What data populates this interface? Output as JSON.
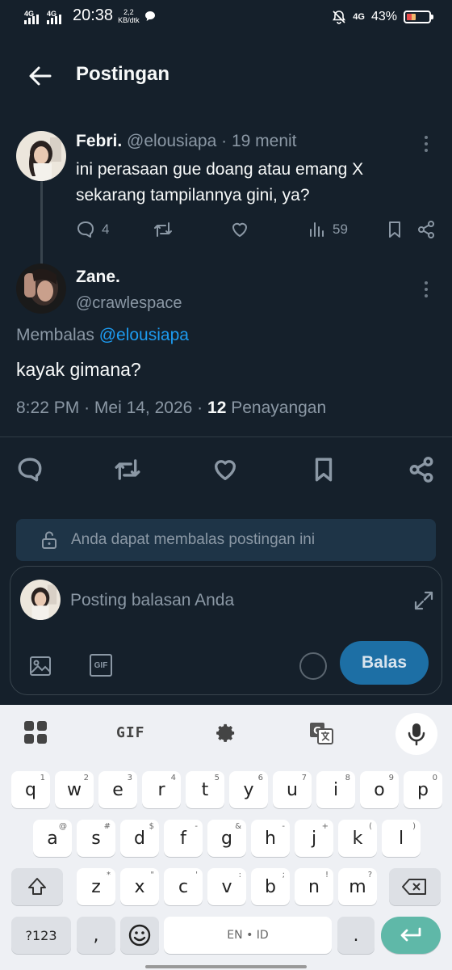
{
  "status_bar": {
    "network1": "4G",
    "network2": "4G",
    "time": "20:38",
    "speed_value": "2,2",
    "speed_unit": "KB/dtk",
    "network3": "4G",
    "battery": "43%",
    "battery_level": 0.43
  },
  "header": {
    "title": "Postingan"
  },
  "parent_post": {
    "name": "Febri.",
    "handle": "@elousiapa",
    "separator": "·",
    "time": "19 menit",
    "text": "ini perasaan gue doang atau emang X sekarang tampilannya gini, ya?",
    "replies": "4",
    "views": "59"
  },
  "main_post": {
    "name": "Zane.",
    "handle": "@crawlespace",
    "reply_prefix": "Membalas",
    "reply_to": "@elousiapa",
    "text": "kayak gimana?",
    "timestamp": "8:22 PM",
    "sep": "·",
    "date": "Mei 14, 2026",
    "views_count": "12",
    "views_label": "Penayangan"
  },
  "reply_notice": "Anda dapat membalas postingan ini",
  "composer": {
    "placeholder": "Posting balasan Anda",
    "gif_label": "GIF",
    "reply_button": "Balas"
  },
  "keyboard": {
    "gif_label": "GIF",
    "row1": [
      [
        "q",
        "1"
      ],
      [
        "w",
        "2"
      ],
      [
        "e",
        "3"
      ],
      [
        "r",
        "4"
      ],
      [
        "t",
        "5"
      ],
      [
        "y",
        "6"
      ],
      [
        "u",
        "7"
      ],
      [
        "i",
        "8"
      ],
      [
        "o",
        "9"
      ],
      [
        "p",
        "0"
      ]
    ],
    "row2": [
      [
        "a",
        "@"
      ],
      [
        "s",
        "#"
      ],
      [
        "d",
        "$"
      ],
      [
        "f",
        "-"
      ],
      [
        "g",
        "&"
      ],
      [
        "h",
        "-"
      ],
      [
        "j",
        "+"
      ],
      [
        "k",
        "("
      ],
      [
        "l",
        ")"
      ]
    ],
    "row3": [
      [
        "z",
        "*"
      ],
      [
        "x",
        "\""
      ],
      [
        "c",
        "'"
      ],
      [
        "v",
        ":"
      ],
      [
        "b",
        ";"
      ],
      [
        "n",
        "!"
      ],
      [
        "m",
        "?"
      ]
    ],
    "symbols_key": "?123",
    "comma_key": ",",
    "space_label": "EN • ID",
    "period_key": "."
  },
  "colors": {
    "background": "#15202b",
    "link": "#1d9bf0",
    "reply_button": "#1d6fa5",
    "enter_key": "#5fb8a8"
  }
}
